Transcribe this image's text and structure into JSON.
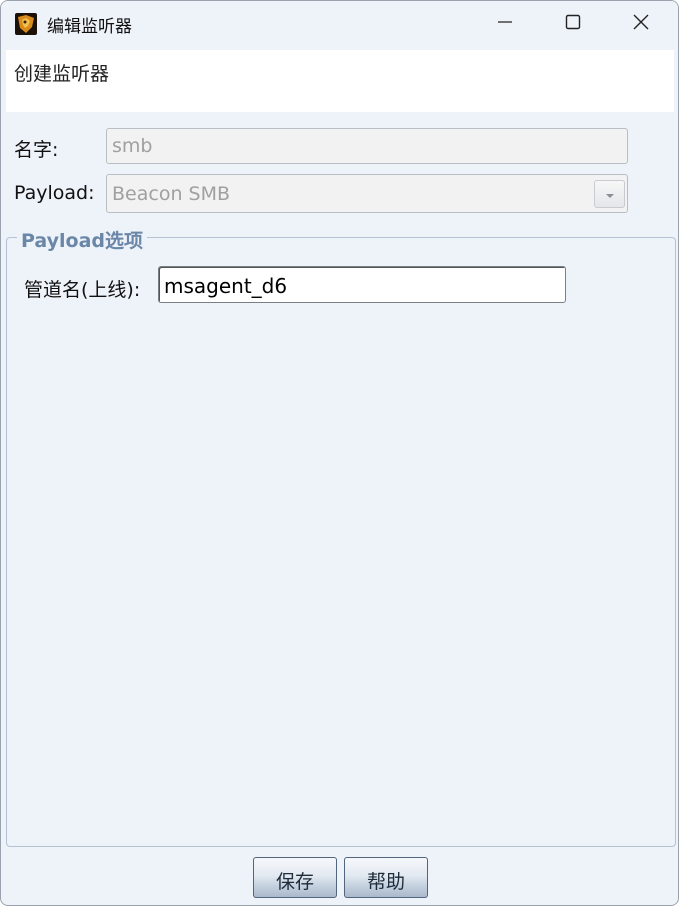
{
  "window": {
    "title": "编辑监听器",
    "icon": "app-logo-icon",
    "controls": [
      "minimize-icon",
      "maximize-icon",
      "close-icon"
    ]
  },
  "header": {
    "text": "创建监听器"
  },
  "form": {
    "name_label": "名字:",
    "name_value": "smb",
    "payload_label": "Payload:",
    "payload_value": "Beacon SMB",
    "payload_dropdown_icon": "chevron-down-icon"
  },
  "payload_options": {
    "legend": "Payload选项",
    "pipe_label": "管道名(上线):",
    "pipe_value": "msagent_d6"
  },
  "buttons": {
    "save": "保存",
    "help": "帮助"
  },
  "colors": {
    "background": "#eef2f9",
    "legend": "#6a87a8",
    "disabled_text": "#a0a0a0"
  }
}
